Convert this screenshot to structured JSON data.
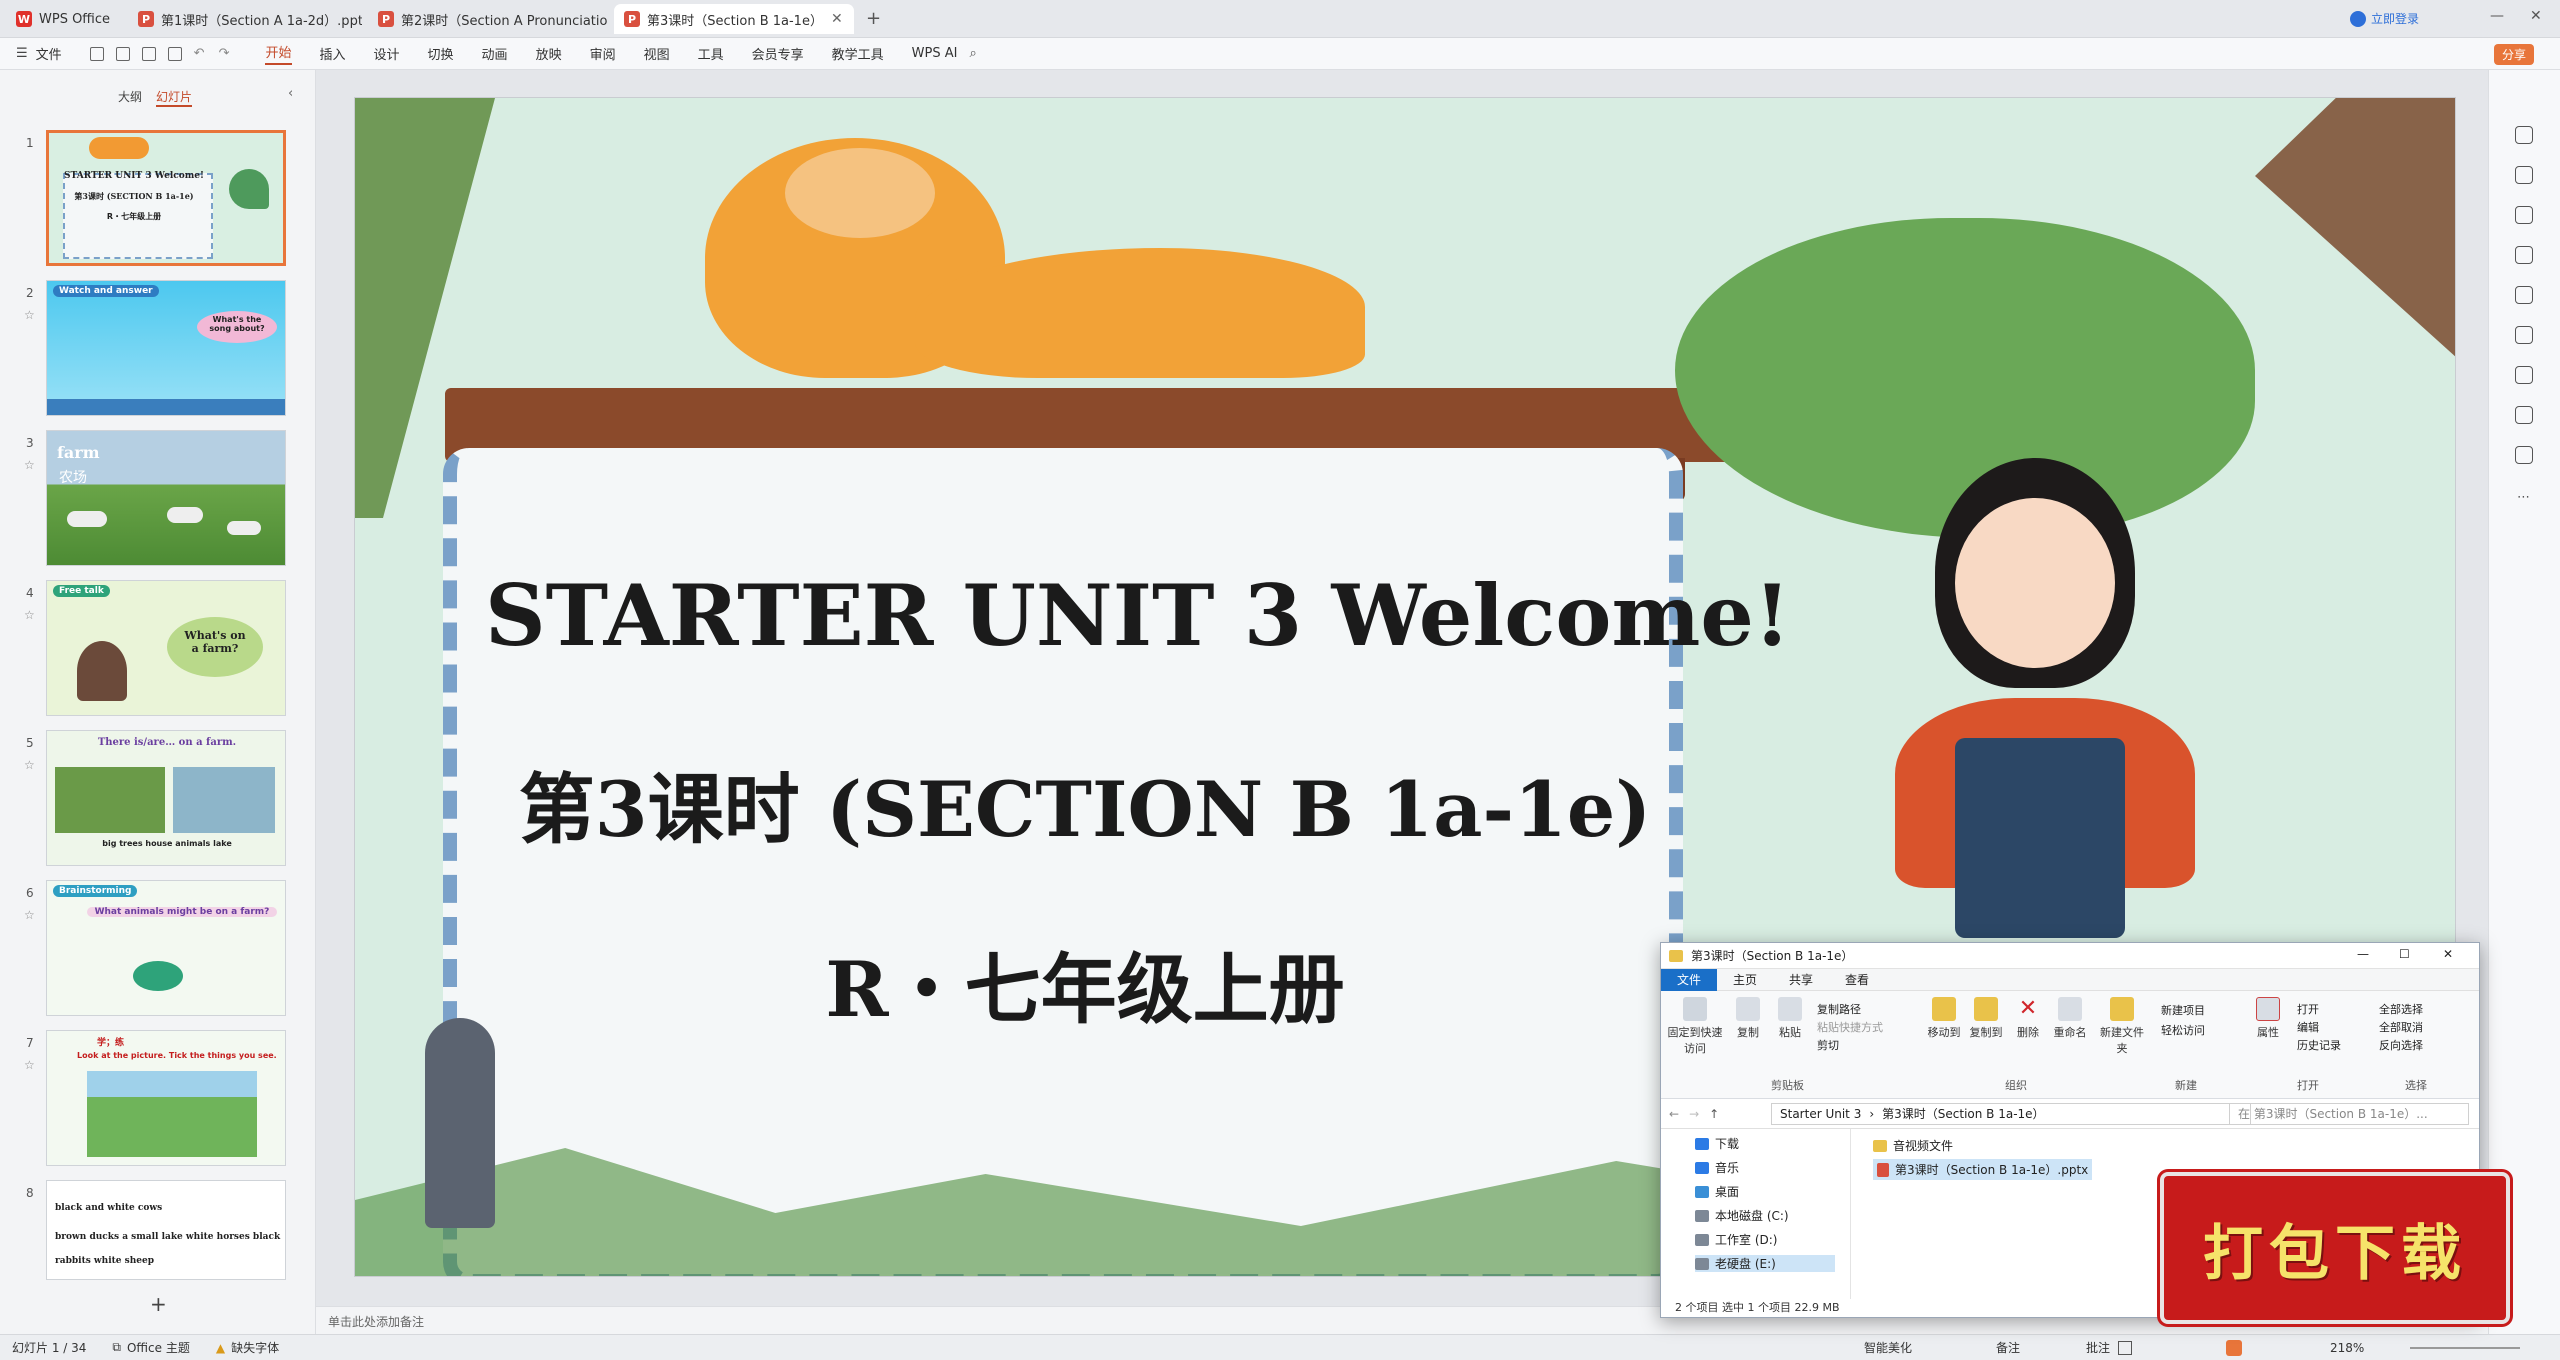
{
  "window_tabs": [
    {
      "label": "WPS Office",
      "icon": "wps-logo-icon"
    },
    {
      "label": "第1课时（Section A 1a-2d）.pptx",
      "icon": "ppt-icon"
    },
    {
      "label": "第2课时（Section A Pronunciation",
      "icon": "ppt-icon"
    },
    {
      "label": "第3课时（Section B 1a-1e）",
      "icon": "ppt-icon"
    }
  ],
  "login_label": "立即登录",
  "menu": {
    "file": "文件",
    "tabs": [
      "开始",
      "插入",
      "设计",
      "切换",
      "动画",
      "放映",
      "审阅",
      "视图",
      "工具",
      "会员专享",
      "教学工具"
    ],
    "wps_ai": "WPS AI",
    "share": "分享"
  },
  "sidebar": {
    "tab_outline": "大纲",
    "tab_slides": "幻灯片",
    "slides": [
      {
        "num": "1",
        "text": "STARTER UNIT 3 Welcome!",
        "sub": "第3课时 (SECTION B 1a-1e)",
        "sub2": "R・七年级上册"
      },
      {
        "num": "2",
        "text": "Watch and answer",
        "sub": "What's the song about?"
      },
      {
        "num": "3",
        "text": "farm",
        "sub": "农场"
      },
      {
        "num": "4",
        "text": "Free talk",
        "sub": "What's on a farm?"
      },
      {
        "num": "5",
        "text": "There is/are… on a farm.",
        "sub": "big trees  house  animals  lake"
      },
      {
        "num": "6",
        "text": "Brainstorming",
        "sub": "What animals might be on a farm?"
      },
      {
        "num": "7",
        "text": "Look at the picture. Tick the things you see.",
        "sub": "学；练"
      },
      {
        "num": "8",
        "text": "black and white cows",
        "sub": "brown ducks  a small lake  white horses  black rabbits  white sheep"
      }
    ],
    "add_label": "+"
  },
  "slide": {
    "title": "STARTER UNIT 3 Welcome!",
    "subtitle": "第3课时 (SECTION B 1a-1e)",
    "grade": "R・七年级上册"
  },
  "notes_placeholder": "单击此处添加备注",
  "status": {
    "slide_count": "幻灯片 1 / 34",
    "theme": "Office 主题",
    "missing_font": "缺失字体",
    "beautify": "智能美化",
    "notes": "备注",
    "comments": "批注",
    "zoom": "218%"
  },
  "explorer": {
    "title": "第3课时（Section B 1a-1e）",
    "tabs": [
      "文件",
      "主页",
      "共享",
      "查看"
    ],
    "ribbon": {
      "pin": "固定到快速访问",
      "copy": "复制",
      "paste": "粘贴",
      "copy_path": "复制路径",
      "paste_shortcut": "粘贴快捷方式",
      "cut": "剪切",
      "move_to": "移动到",
      "copy_to": "复制到",
      "delete": "删除",
      "rename": "重命名",
      "new_folder": "新建文件夹",
      "new_item": "新建项目",
      "easy_access": "轻松访问",
      "properties": "属性",
      "open": "打开",
      "edit": "编辑",
      "history": "历史记录",
      "select_all": "全部选择",
      "select_none": "全部取消",
      "invert": "反向选择",
      "groups": [
        "剪贴板",
        "组织",
        "新建",
        "打开",
        "选择"
      ]
    },
    "breadcrumb": [
      "Starter Unit 3",
      "第3课时（Section B 1a-1e）"
    ],
    "search_placeholder": "在 第3课时（Section B 1a-1e）...",
    "nav": [
      "下载",
      "音乐",
      "桌面",
      "本地磁盘 (C:)",
      "工作室 (D:)",
      "老硬盘 (E:)"
    ],
    "files": [
      "音视频文件",
      "第3课时（Section B 1a-1e）.pptx"
    ],
    "status": "2 个项目    选中 1 个项目  22.9 MB"
  },
  "stamp_text": "打包下载"
}
